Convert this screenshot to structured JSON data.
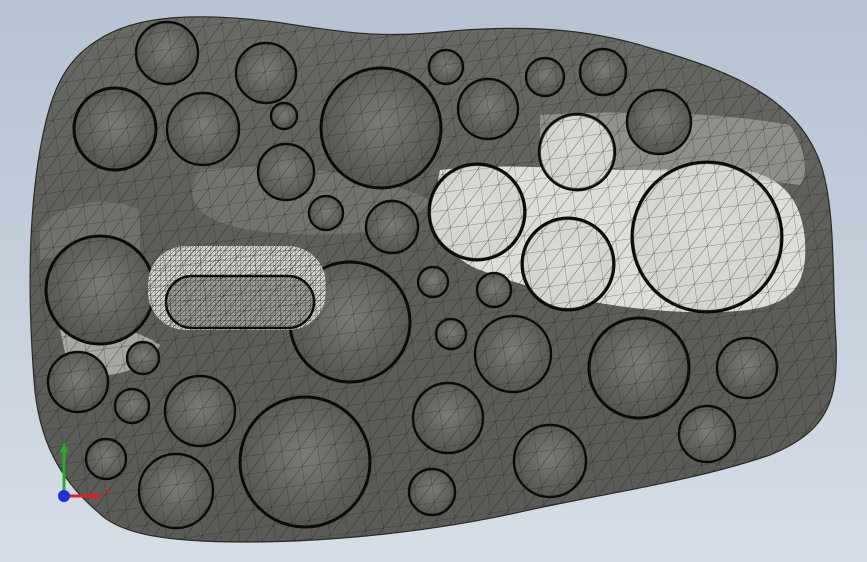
{
  "viewport": {
    "background": "#c3cedb",
    "model_fill": "#5e5e5a",
    "highlight_fill": "#f4f4ef",
    "mesh_color": "#1b1b19",
    "hole_rim_color": "#0a0a0a"
  },
  "triad": {
    "x_label": "X",
    "x_color": "#e02020",
    "y_color": "#22b022",
    "z_color": "#2030e0"
  }
}
